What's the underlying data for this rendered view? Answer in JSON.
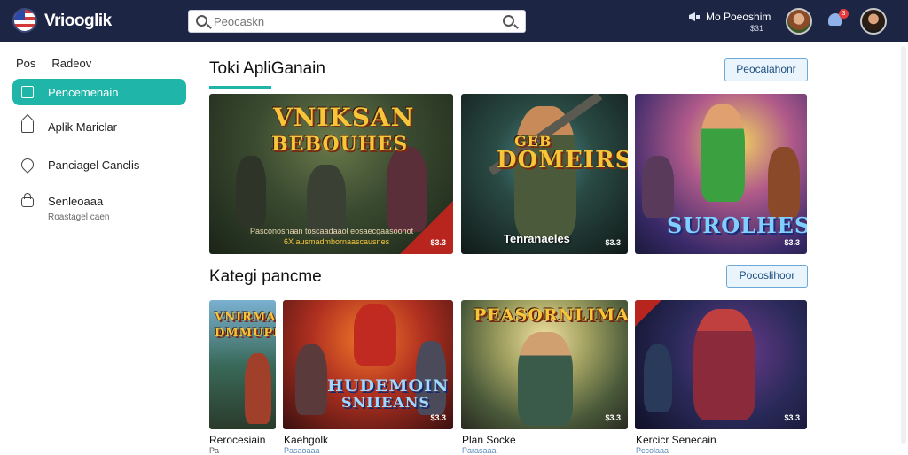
{
  "app": {
    "name": "Vriooglik"
  },
  "search": {
    "placeholder": "Peocaskn"
  },
  "user": {
    "name": "Mo Poeoshim",
    "sub": "$31",
    "notifications": "3"
  },
  "sidebar": {
    "header": [
      "Pos",
      "Radeov"
    ],
    "items": [
      {
        "label": "Pencemenain",
        "icon": "inbox-icon",
        "active": true
      },
      {
        "label": "Aplik Mariclar",
        "icon": "home-icon"
      },
      {
        "label": "Panciagel Canclis",
        "icon": "tag-icon"
      },
      {
        "label": "Senleoaaa",
        "sub": "Roastagel caen",
        "icon": "lock-icon"
      }
    ]
  },
  "section1": {
    "title": "Toki ApliGanain",
    "button": "Peocalahonr",
    "cards": [
      {
        "title_line1": "VNIKSAN",
        "title_line2": "BEBOUHES",
        "fine1": "Pasconosnaan toscaadaaol eosaecgaasoonot",
        "fine2": "6X ausmadmbornaascausnes",
        "price": "$3.3"
      },
      {
        "title_line1": "GEB",
        "title_line2": "DOMEIRS",
        "caption": "Tenranaeles",
        "price": "$3.3"
      },
      {
        "title_line1": "SUROLHES",
        "price": "$3.3"
      }
    ]
  },
  "section2": {
    "title": "Kategi pancme",
    "button": "Pocoslihoor",
    "cards": [
      {
        "title_line1": "VNIRMAN",
        "title_line2": "DMMUPEK",
        "label": "Rerocesiain",
        "sub": "Pa"
      },
      {
        "title_line1": "HUDEMOIN",
        "title_line2": "SNIIEANS",
        "label": "Kaehgolk",
        "sub": "Pasaoaaa",
        "price": "$3.3"
      },
      {
        "title_line1": "PEASORNLIMAS",
        "label": "Plan Socke",
        "sub": "Parasaaa",
        "price": "$3.3"
      },
      {
        "label": "Kercicr Senecain",
        "sub": "Pccolaaa",
        "price": "$3.3"
      }
    ]
  },
  "colors": {
    "topbar": "#1d2545",
    "accent": "#1fb5a9",
    "button_border": "#6da8d8"
  }
}
